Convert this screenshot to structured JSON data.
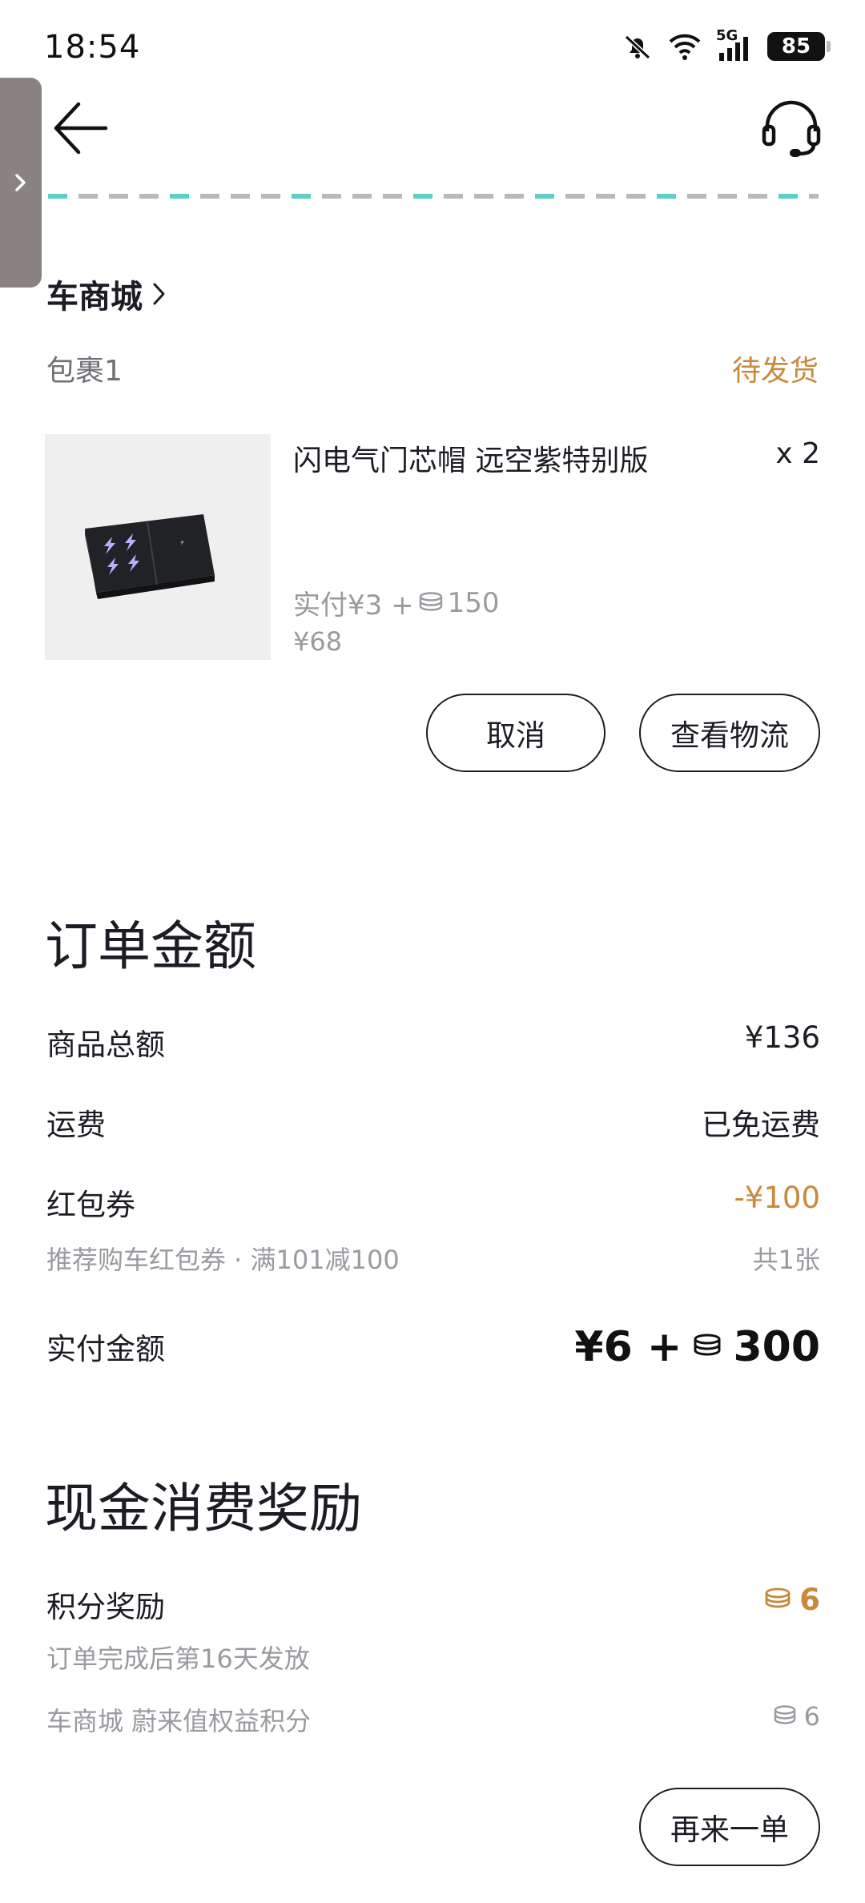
{
  "status_bar": {
    "time": "18:54",
    "network": "5G",
    "battery": "85"
  },
  "nav": {
    "back_icon": "arrow-left-icon",
    "support_icon": "headset-icon",
    "side_tab_icon": "chevron-right-icon"
  },
  "store": {
    "title": "车商城",
    "package_label": "包裹1",
    "package_status": "待发货"
  },
  "product": {
    "name": "闪电气门芯帽 远空紫特别版",
    "qty": "x 2",
    "paid_cash": "实付¥3 +",
    "paid_points": "150",
    "original_price": "¥68"
  },
  "actions": {
    "cancel": "取消",
    "logistics": "查看物流",
    "reorder": "再来一单"
  },
  "order_amount": {
    "title": "订单金额",
    "goods_total_label": "商品总额",
    "goods_total_value": "¥136",
    "shipping_label": "运费",
    "shipping_value": "已免运费",
    "coupon_label": "红包券",
    "coupon_value": "-¥100",
    "coupon_desc": "推荐购车红包券 · 满101减100",
    "coupon_count": "共1张",
    "paid_label": "实付金额",
    "paid_cash": "¥6 +",
    "paid_points": "300"
  },
  "reward": {
    "title": "现金消费奖励",
    "points_label": "积分奖励",
    "points_value": "6",
    "points_note": "订单完成后第16天发放",
    "detail_label": "车商城 蔚来值权益积分",
    "detail_value": "6"
  },
  "colors": {
    "accent": "#c8893b",
    "text": "#1c1d24",
    "muted": "#9a9aa0",
    "teal": "#5ccfc8"
  }
}
